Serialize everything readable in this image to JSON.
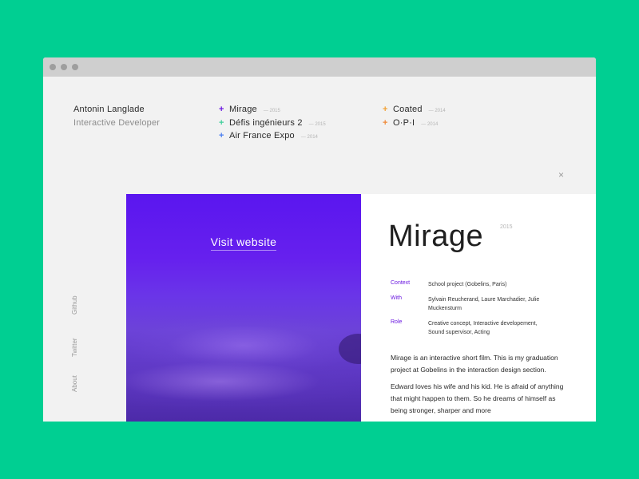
{
  "author": {
    "name": "Antonin Langlade",
    "role": "Interactive Developer"
  },
  "projects_col1": [
    {
      "name": "Mirage",
      "year": "— 2015",
      "color": "#6a17e0"
    },
    {
      "name": "Défis ingénieurs 2",
      "year": "— 2015",
      "color": "#3fcf9b"
    },
    {
      "name": "Air France Expo",
      "year": "— 2014",
      "color": "#4a7ef0"
    }
  ],
  "projects_col2": [
    {
      "name": "Coated",
      "year": "— 2014",
      "color": "#f2a236"
    },
    {
      "name": "O·P·I",
      "year": "— 2014",
      "color": "#f08a3a"
    }
  ],
  "close_label": "×",
  "social": {
    "github": "Github",
    "twitter": "Twitter",
    "about": "About"
  },
  "hero": {
    "visit_label": "Visit website"
  },
  "detail": {
    "title": "Mirage",
    "year": "2015",
    "meta": [
      {
        "label": "Context",
        "value": "School project (Gobelins, Paris)"
      },
      {
        "label": "With",
        "value": "Sylvain Reucherand, Laure Marchadier, Julie Muckensturm"
      },
      {
        "label": "Role",
        "value": "Creative concept, Interactive developement, Sound supervisor, Acting"
      }
    ],
    "description": [
      "Mirage is an interactive short film. This is my graduation project at Gobelins in the interaction design section.",
      "Edward loves his wife and his kid. He is afraid of anything that might happen to them. So he dreams of himself as being stronger, sharper and more"
    ]
  },
  "colors": {
    "background": "#00CF92",
    "accent": "#6a17e0"
  }
}
